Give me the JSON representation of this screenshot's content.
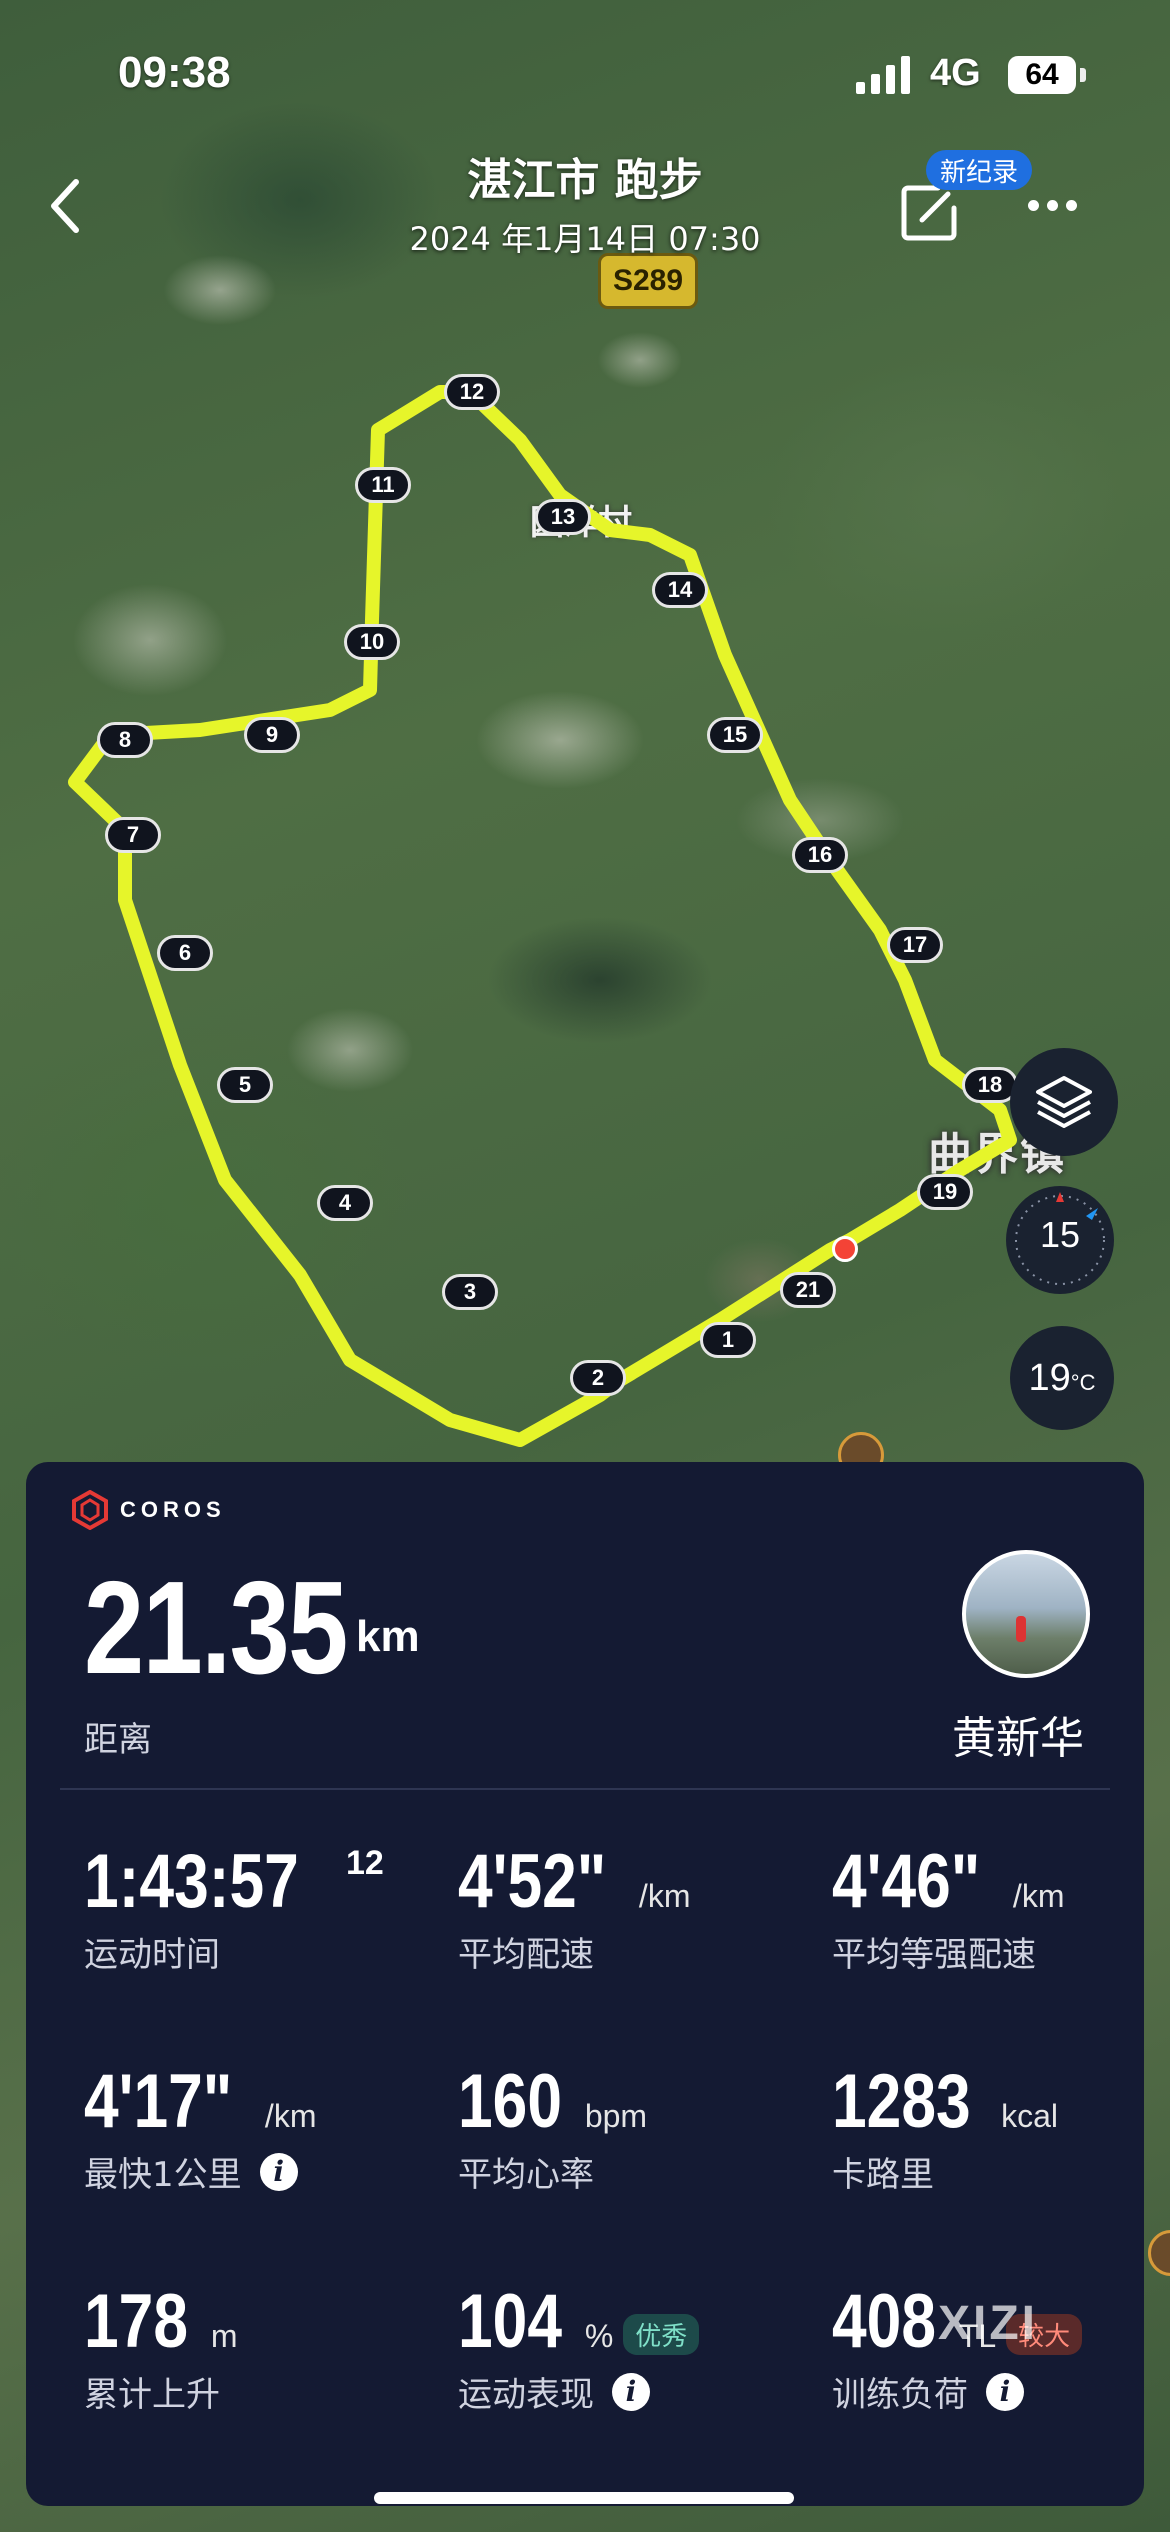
{
  "status_bar": {
    "time": "09:38",
    "network": "4G",
    "battery": "64"
  },
  "header": {
    "title": "湛江市 跑步",
    "subtitle": "2024 年1月14日 07:30",
    "new_record_badge": "新纪录"
  },
  "map": {
    "road_label": "S289",
    "town_label": "曲界镇",
    "village_label": "园洋村",
    "km_markers": [
      "1",
      "2",
      "3",
      "4",
      "5",
      "6",
      "7",
      "8",
      "9",
      "10",
      "11",
      "12",
      "13",
      "14",
      "15",
      "16",
      "17",
      "18",
      "19",
      "21"
    ],
    "compass_value": "15",
    "temperature": "19",
    "temperature_unit": "°C",
    "route_color": "#e6f52a"
  },
  "card": {
    "brand": "COROS",
    "distance": {
      "value": "21.35",
      "unit": "km",
      "label": "距离"
    },
    "user_name": "黄新华",
    "stats": [
      {
        "value": "1:43:57",
        "sup": "12",
        "unit": "",
        "label": "运动时间",
        "info": false,
        "badge": ""
      },
      {
        "value": "4'52\"",
        "sup": "",
        "unit": "/km",
        "label": "平均配速",
        "info": false,
        "badge": ""
      },
      {
        "value": "4'46\"",
        "sup": "",
        "unit": "/km",
        "label": "平均等强配速",
        "info": false,
        "badge": ""
      },
      {
        "value": "4'17\"",
        "sup": "",
        "unit": "/km",
        "label": "最快1公里",
        "info": true,
        "badge": ""
      },
      {
        "value": "160",
        "sup": "",
        "unit": "bpm",
        "label": "平均心率",
        "info": false,
        "badge": ""
      },
      {
        "value": "1283",
        "sup": "",
        "unit": "kcal",
        "label": "卡路里",
        "info": false,
        "badge": ""
      },
      {
        "value": "178",
        "sup": "",
        "unit": "m",
        "label": "累计上升",
        "info": false,
        "badge": ""
      },
      {
        "value": "104",
        "sup": "",
        "unit": "%",
        "label": "运动表现",
        "info": true,
        "badge": "优秀"
      },
      {
        "value": "408",
        "sup": "",
        "unit": "TL",
        "label": "训练负荷",
        "info": true,
        "badge": "较大"
      }
    ],
    "info_glyph": "i"
  },
  "watermark": "XIZI"
}
